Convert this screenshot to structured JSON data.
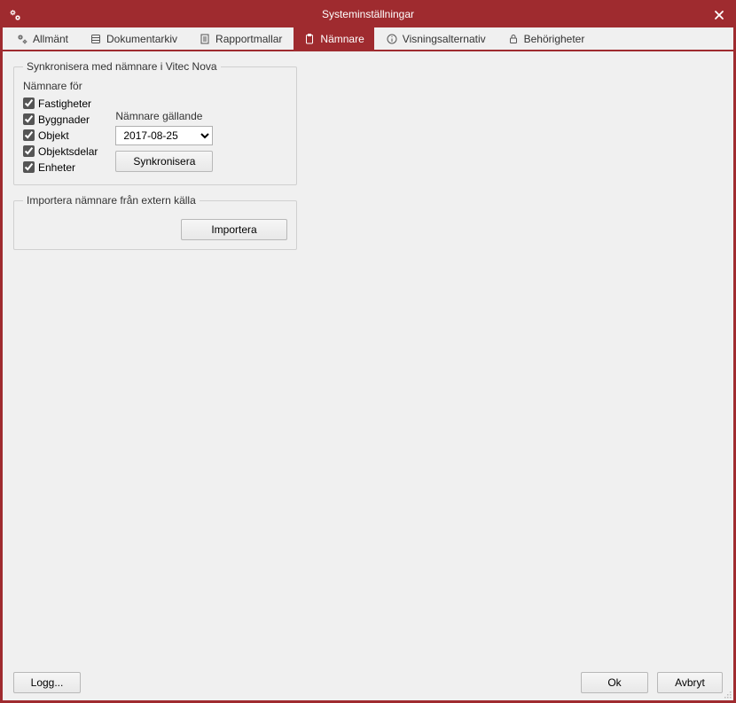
{
  "window": {
    "title": "Systeminställningar"
  },
  "tabs": {
    "t0": {
      "label": "Allmänt"
    },
    "t1": {
      "label": "Dokumentarkiv"
    },
    "t2": {
      "label": "Rapportmallar"
    },
    "t3": {
      "label": "Nämnare"
    },
    "t4": {
      "label": "Visningsalternativ"
    },
    "t5": {
      "label": "Behörigheter"
    }
  },
  "sync": {
    "legend": "Synkronisera med nämnare i Vitec Nova",
    "namnare_for_label": "Nämnare för",
    "checkboxes": {
      "c0": "Fastigheter",
      "c1": "Byggnader",
      "c2": "Objekt",
      "c3": "Objektsdelar",
      "c4": "Enheter"
    },
    "date_label": "Nämnare gällande",
    "date_value": "2017-08-25",
    "sync_button": "Synkronisera"
  },
  "import": {
    "legend": "Importera nämnare från extern källa",
    "button": "Importera"
  },
  "footer": {
    "logg": "Logg...",
    "ok": "Ok",
    "cancel": "Avbryt"
  }
}
